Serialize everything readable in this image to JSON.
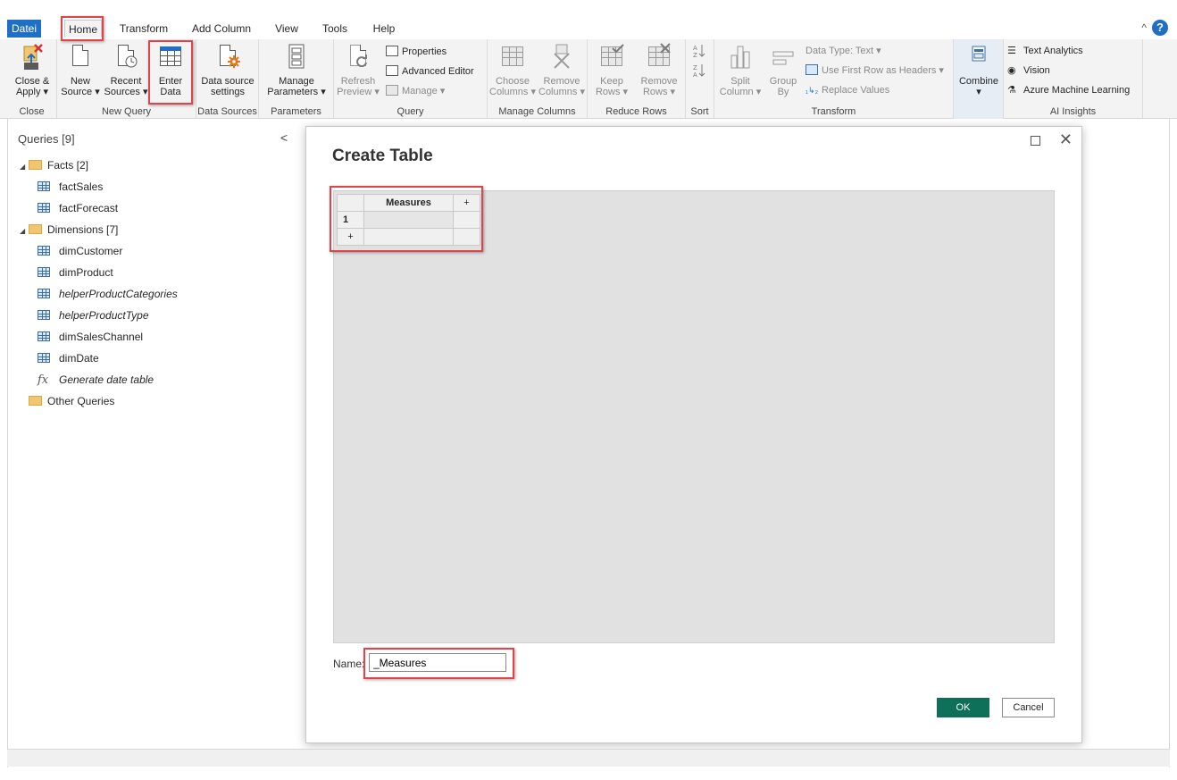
{
  "tabs": [
    {
      "label": "Datei"
    },
    {
      "label": "Home"
    },
    {
      "label": "Transform"
    },
    {
      "label": "Add Column"
    },
    {
      "label": "View"
    },
    {
      "label": "Tools"
    },
    {
      "label": "Help"
    }
  ],
  "ribbon": {
    "close": {
      "close_apply": {
        "line1": "Close &",
        "line2": "Apply ▾"
      },
      "label": "Close"
    },
    "new_query": {
      "new_source": {
        "line1": "New",
        "line2": "Source ▾"
      },
      "recent_sources": {
        "line1": "Recent",
        "line2": "Sources ▾"
      },
      "enter_data": {
        "line1": "Enter",
        "line2": "Data"
      },
      "label": "New Query"
    },
    "data_sources": {
      "settings": {
        "line1": "Data source",
        "line2": "settings"
      },
      "label": "Data Sources"
    },
    "parameters": {
      "manage": {
        "line1": "Manage",
        "line2": "Parameters ▾"
      },
      "label": "Parameters"
    },
    "query": {
      "refresh": {
        "line1": "Refresh",
        "line2": "Preview ▾"
      },
      "properties": "Properties",
      "advanced_editor": "Advanced Editor",
      "manage": "Manage ▾",
      "label": "Query"
    },
    "manage_columns": {
      "choose": {
        "line1": "Choose",
        "line2": "Columns ▾"
      },
      "remove": {
        "line1": "Remove",
        "line2": "Columns ▾"
      },
      "label": "Manage Columns"
    },
    "reduce_rows": {
      "keep": {
        "line1": "Keep",
        "line2": "Rows ▾"
      },
      "remove": {
        "line1": "Remove",
        "line2": "Rows ▾"
      },
      "label": "Reduce Rows"
    },
    "sort": {
      "label": "Sort"
    },
    "transform": {
      "split": {
        "line1": "Split",
        "line2": "Column ▾"
      },
      "group": {
        "line1": "Group",
        "line2": "By"
      },
      "data_type": "Data Type: Text ▾",
      "first_row": "Use First Row as Headers ▾",
      "replace": "Replace Values",
      "label": "Transform"
    },
    "combine": {
      "label": "Combine",
      "caret": "▾"
    },
    "ai": {
      "text_analytics": "Text Analytics",
      "vision": "Vision",
      "azure_ml": "Azure Machine Learning",
      "label": "AI Insights"
    }
  },
  "queries": {
    "title": "Queries [9]",
    "collapse": "<",
    "facts_folder": "Facts [2]",
    "facts": [
      "factSales",
      "factForecast"
    ],
    "dimensions_folder": "Dimensions [7]",
    "dimensions": [
      "dimCustomer",
      "dimProduct",
      "helperProductCategories",
      "helperProductType",
      "dimSalesChannel",
      "dimDate",
      "Generate date table"
    ],
    "other_folder": "Other Queries"
  },
  "dialog": {
    "title": "Create Table",
    "table": {
      "column_header": "Measures",
      "add_column": "+",
      "row_number": "1",
      "add_row": "+"
    },
    "name_label": "Name:",
    "name_value": "_Measures",
    "ok": "OK",
    "cancel": "Cancel",
    "close_glyph": "✕"
  },
  "help": "?",
  "collapse_ribbon": "^",
  "colors": {
    "file_tab": "#1f6fc5",
    "ok_button": "#0f7059",
    "highlight": "#e0444a"
  }
}
